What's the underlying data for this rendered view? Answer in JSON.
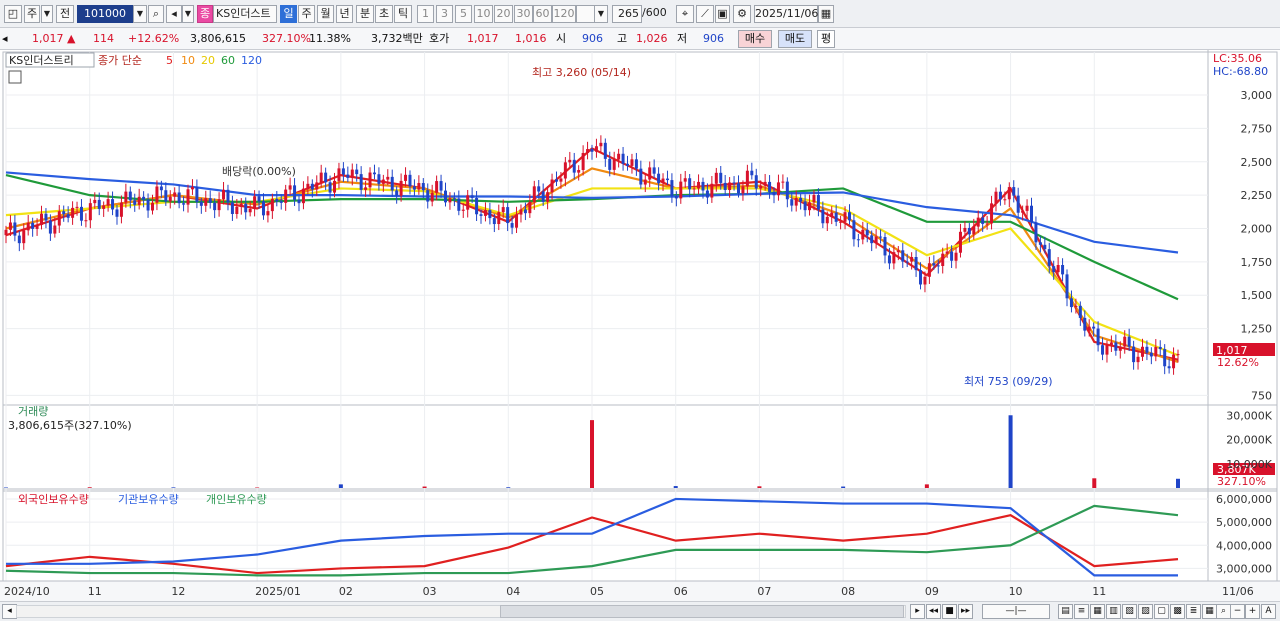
{
  "toolbar": {
    "type_primary": "주",
    "type_secondary": "전",
    "code": "101000",
    "badge": "종",
    "stock_name": "KS인더스트",
    "periods": [
      "일",
      "주",
      "월",
      "년",
      "분",
      "초",
      "틱"
    ],
    "active_period": "일",
    "minutes": [
      "1",
      "3",
      "5",
      "10",
      "20",
      "30",
      "60",
      "120"
    ],
    "count": "265",
    "count_total": "/600",
    "date": "2025/11/06"
  },
  "quote": {
    "price": "1,017",
    "arrow": "▲",
    "change": "114",
    "change_pct": "+12.62%",
    "volume": "3,806,615",
    "volume_ratio": "327.10%",
    "turnover": "11.38%",
    "amount": "3,732백만",
    "bid_label": "호가",
    "bid": "1,017",
    "ask": "1,016",
    "open_label": "시",
    "open": "906",
    "high_label": "고",
    "high": "1,026",
    "low_label": "저",
    "low": "906",
    "buy_label": "매수",
    "sell_label": "매도",
    "eval_label": "평"
  },
  "price_panel": {
    "name": "KS인더스트리",
    "ma_title": "종가 단순",
    "ma_periods": [
      "5",
      "10",
      "20",
      "60",
      "120"
    ],
    "ma_colors": [
      "#e02020",
      "#f08a10",
      "#f2e214",
      "#1f9a3a",
      "#2a5de0"
    ],
    "high_annot": "최고 3,260 (05/14)",
    "low_annot": "최저 753 (09/29)",
    "dividend_annot": "배당락(0.00%)",
    "lc": "LC:35.06",
    "hc": "HC:-68.80",
    "y_ticks": [
      "3,000",
      "2,750",
      "2,500",
      "2,250",
      "2,000",
      "1,750",
      "1,500",
      "1,250",
      "750"
    ],
    "last_price": "1,017",
    "last_pct": "12.62%"
  },
  "volume_panel": {
    "title": "거래량",
    "value": "3,806,615주(327.10%)",
    "y_ticks": [
      "30,000K",
      "20,000K",
      "10,000K"
    ],
    "last": "3,807K",
    "last_pct": "327.10%"
  },
  "holdings_panel": {
    "legend": [
      "외국인보유수량",
      "기관보유수량",
      "개인보유수량"
    ],
    "colors": [
      "#e02020",
      "#2a5de0",
      "#2e9a55"
    ],
    "y_ticks": [
      "6,000,000",
      "5,000,000",
      "4,000,000",
      "3,000,000"
    ]
  },
  "x_axis": [
    "2024/10",
    "11",
    "12",
    "2025/01",
    "02",
    "03",
    "04",
    "05",
    "06",
    "07",
    "08",
    "09",
    "10",
    "11",
    "11/06"
  ],
  "chart_data": {
    "type": "line",
    "title": "KS인더스트리",
    "ylim": [
      700,
      3300
    ],
    "x": [
      "2024/10",
      "11",
      "12",
      "2025/01",
      "02",
      "03",
      "04",
      "05",
      "06",
      "07",
      "08",
      "09",
      "10",
      "11",
      "11/06"
    ],
    "series": [
      {
        "name": "5",
        "values": [
          1950,
          2150,
          2250,
          2150,
          2400,
          2300,
          2050,
          2600,
          2300,
          2350,
          2050,
          1650,
          2300,
          1150,
          1017
        ]
      },
      {
        "name": "10",
        "values": [
          2000,
          2150,
          2250,
          2180,
          2350,
          2300,
          2080,
          2450,
          2300,
          2320,
          2100,
          1700,
          2150,
          1200,
          1000
        ]
      },
      {
        "name": "20",
        "values": [
          2100,
          2150,
          2200,
          2200,
          2300,
          2280,
          2100,
          2300,
          2300,
          2300,
          2150,
          1800,
          2000,
          1300,
          1050
        ]
      },
      {
        "name": "60",
        "values": [
          2400,
          2250,
          2200,
          2200,
          2220,
          2220,
          2200,
          2220,
          2250,
          2260,
          2300,
          2050,
          2050,
          1750,
          1470
        ]
      },
      {
        "name": "120",
        "values": [
          2420,
          2370,
          2330,
          2250,
          2250,
          2240,
          2240,
          2230,
          2240,
          2260,
          2270,
          2160,
          2100,
          1900,
          1820
        ]
      }
    ],
    "volume_k": [
      200,
      300,
      250,
      200,
      1500,
      600,
      300,
      28000,
      800,
      700,
      600,
      1500,
      30000,
      4000,
      3807
    ],
    "holdings": [
      {
        "name": "외국인보유수량",
        "values": [
          3100,
          3500,
          3200,
          2800,
          3000,
          3100,
          3900,
          5200,
          4200,
          4500,
          4200,
          4500,
          5300,
          3100,
          3400
        ]
      },
      {
        "name": "기관보유수량",
        "values": [
          3200,
          3200,
          3300,
          3600,
          4200,
          4400,
          4500,
          4500,
          6000,
          5900,
          5800,
          5800,
          5600,
          2700,
          2700
        ]
      },
      {
        "name": "개인보유수량",
        "values": [
          2900,
          2800,
          2800,
          2700,
          2700,
          2800,
          2800,
          3100,
          3800,
          3800,
          3800,
          3700,
          4000,
          5700,
          5300
        ]
      }
    ]
  }
}
